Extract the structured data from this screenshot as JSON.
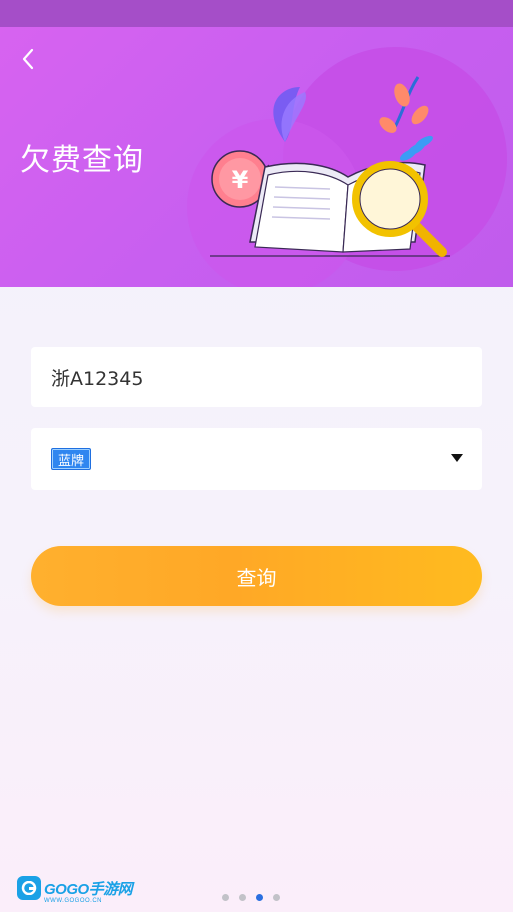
{
  "header": {
    "title": "欠费查询"
  },
  "form": {
    "plate_number": "浙A12345",
    "plate_color": "蓝牌",
    "query_button_label": "查询"
  },
  "illustration": {
    "currency_symbol": "¥"
  },
  "watermark": {
    "brand": "GOGO手游网",
    "domain": "WWW.GOGOO.CN"
  },
  "pager": {
    "total_pages": 4,
    "active_page": 3
  },
  "colors": {
    "status_bar": "#a54ec8",
    "header_bg": "#d763f0",
    "button_orange": "#ffa826",
    "plate_blue": "#2f86f0",
    "active_dot": "#2a6fe0"
  },
  "icons": {
    "back": "chevron-left-icon",
    "dropdown": "triangle-down-icon"
  }
}
